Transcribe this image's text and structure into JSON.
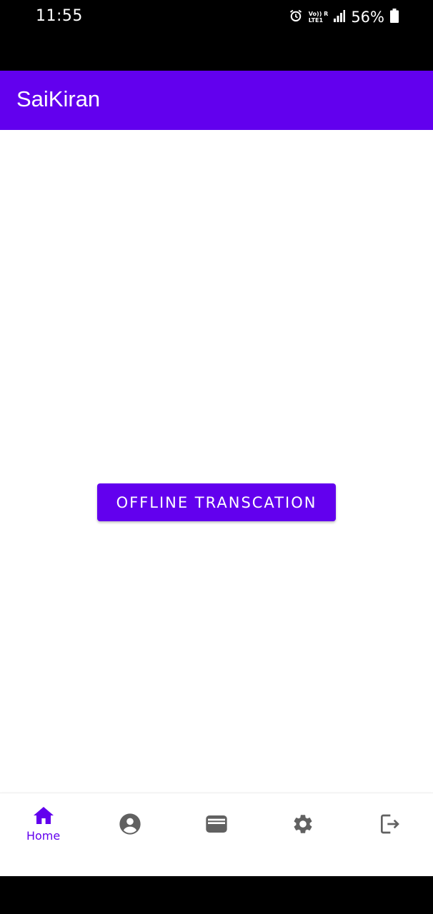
{
  "status_bar": {
    "time": "11:55",
    "network_top": "Vo)) R",
    "network_bottom": "LTE1",
    "battery": "56%",
    "icons": [
      "alarm-icon",
      "signal-icon",
      "battery-icon"
    ]
  },
  "app_bar": {
    "title": "SaiKiran"
  },
  "main": {
    "button_label": "OFFLINE TRANSCATION"
  },
  "bottom_nav": {
    "items": [
      {
        "label": "Home",
        "icon": "home-icon",
        "active": true
      },
      {
        "label": "",
        "icon": "account-icon",
        "active": false
      },
      {
        "label": "",
        "icon": "wallet-icon",
        "active": false
      },
      {
        "label": "",
        "icon": "settings-icon",
        "active": false
      },
      {
        "label": "",
        "icon": "logout-icon",
        "active": false
      }
    ]
  },
  "colors": {
    "primary": "#6200ee",
    "inactive_icon": "#616161",
    "background": "#ffffff"
  }
}
